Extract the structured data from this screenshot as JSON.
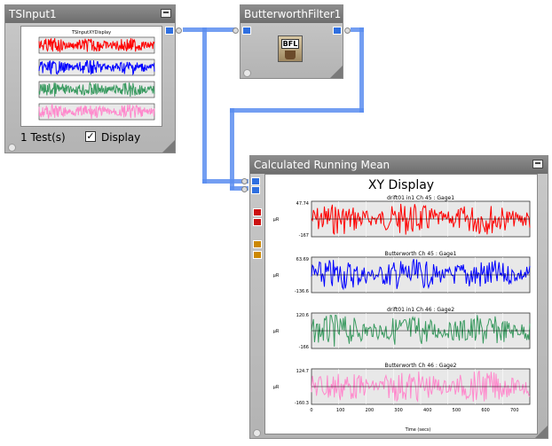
{
  "nodes": {
    "tsinput": {
      "title": "TSInput1",
      "tests_label": "1 Test(s)",
      "display_label": "Display",
      "display_checked": true,
      "thumb_title": "TSInputXYDisplay"
    },
    "filter": {
      "title": "ButterworthFilter1",
      "icon_label": "BFL"
    },
    "running": {
      "title": "Calculated Running Mean"
    }
  },
  "display": {
    "title": "XY Display",
    "xlabel": "Time (secs)",
    "ylabel": "μR",
    "x_ticks": [
      "0",
      "100",
      "200",
      "300",
      "400",
      "500",
      "600",
      "700"
    ],
    "plots": [
      {
        "title": "drift01    in1  Ch 45 : Gage1",
        "color": "#ff0000",
        "ymax": "47.74",
        "ymin": "-167"
      },
      {
        "title": "Butterworth  Ch 45 : Gage1",
        "color": "#0000ff",
        "ymax": "63.69",
        "ymin": "-136.6"
      },
      {
        "title": "drift01    in1  Ch 46 : Gage2",
        "color": "#3a9a60",
        "ymax": "120.6",
        "ymin": "-166"
      },
      {
        "title": "Butterworth  Ch 46 : Gage2",
        "color": "#ff88cc",
        "ymax": "124.7",
        "ymin": "-160.3"
      }
    ]
  },
  "colors": {
    "wire": "#5b8df0",
    "port": "#2f6fe0"
  }
}
